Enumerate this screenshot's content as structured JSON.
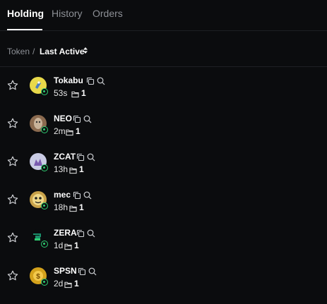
{
  "tabs": [
    {
      "label": "Holding",
      "active": true
    },
    {
      "label": "History",
      "active": false
    },
    {
      "label": "Orders",
      "active": false
    }
  ],
  "sort": {
    "token_label": "Token",
    "separator": "/",
    "active_label": "Last Active"
  },
  "rows": [
    {
      "name": "Tokabu",
      "age": "53s",
      "holders": "1",
      "avatar_color": "#e8d94a"
    },
    {
      "name": "NEO",
      "age": "2m",
      "holders": "1",
      "avatar_color": "#8b6a4f"
    },
    {
      "name": "ZCAT",
      "age": "13h",
      "holders": "1",
      "avatar_color": "#c9cbe4"
    },
    {
      "name": "mec",
      "age": "18h",
      "holders": "1",
      "avatar_color": "#c9a24a"
    },
    {
      "name": "ZERA",
      "age": "1d",
      "holders": "1",
      "avatar_color": "#1a8f6a"
    },
    {
      "name": "SPSN",
      "age": "2d",
      "holders": "1",
      "avatar_color": "#d4a21c"
    }
  ],
  "colors": {
    "background": "#0b0c0e",
    "muted_text": "#8d9096",
    "badge_green": "#2ecc71"
  },
  "icons": [
    "star-icon",
    "copy-icon",
    "search-icon",
    "folder-icon",
    "sort-icon"
  ]
}
